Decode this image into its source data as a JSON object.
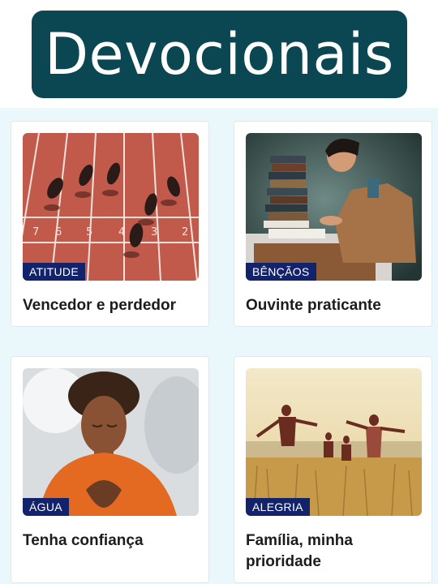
{
  "header": {
    "title": "Devocionais"
  },
  "cards": [
    {
      "tag": "ATITUDE",
      "title": "Vencedor e perdedor",
      "image": "running-track-sprinters"
    },
    {
      "tag": "BÊNÇÃOS",
      "title": "Ouvinte praticante",
      "image": "man-studying-books"
    },
    {
      "tag": "ÁGUA",
      "title": "Tenha confiança",
      "image": "woman-hands-on-heart"
    },
    {
      "tag": "ALEGRIA",
      "title": "Família, minha prioridade",
      "image": "family-running-field"
    }
  ],
  "colors": {
    "banner": "#0b4752",
    "tag_bg": "#13236b",
    "content_bg": "#eaf7fb"
  }
}
